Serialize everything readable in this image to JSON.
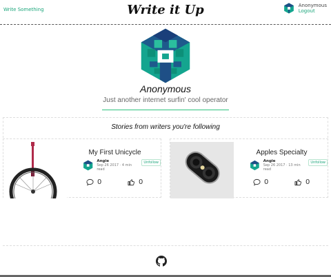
{
  "header": {
    "write_link": "Write Something",
    "logo": "Write it Up",
    "user_name": "Anonymous",
    "logout": "Logout"
  },
  "profile": {
    "name": "Anonymous",
    "bio": "Just another internet surfin' cool operator"
  },
  "following": {
    "title": "Stories from writers you're following"
  },
  "stories": [
    {
      "title": "My First Unicycle",
      "author": "Angie",
      "meta": "Sep 26 2017 · 4 min read",
      "unfollow": "Unfollow",
      "comments": "0",
      "likes": "0",
      "image_icon": "unicycle-image"
    },
    {
      "title": "Apples Specialty",
      "author": "Angie",
      "meta": "Sep 26 2017 · 13 min read",
      "unfollow": "Unfollow",
      "comments": "0",
      "likes": "0",
      "image_icon": "phone-camera-image"
    }
  ],
  "icons": {
    "avatar": "geometric-avatar-icon",
    "comment": "comment-icon",
    "like": "thumbs-up-icon",
    "github": "github-icon"
  },
  "colors": {
    "accent": "#1aa57a",
    "avatar_teal": "#12a58f",
    "avatar_dark": "#1e4f86"
  }
}
